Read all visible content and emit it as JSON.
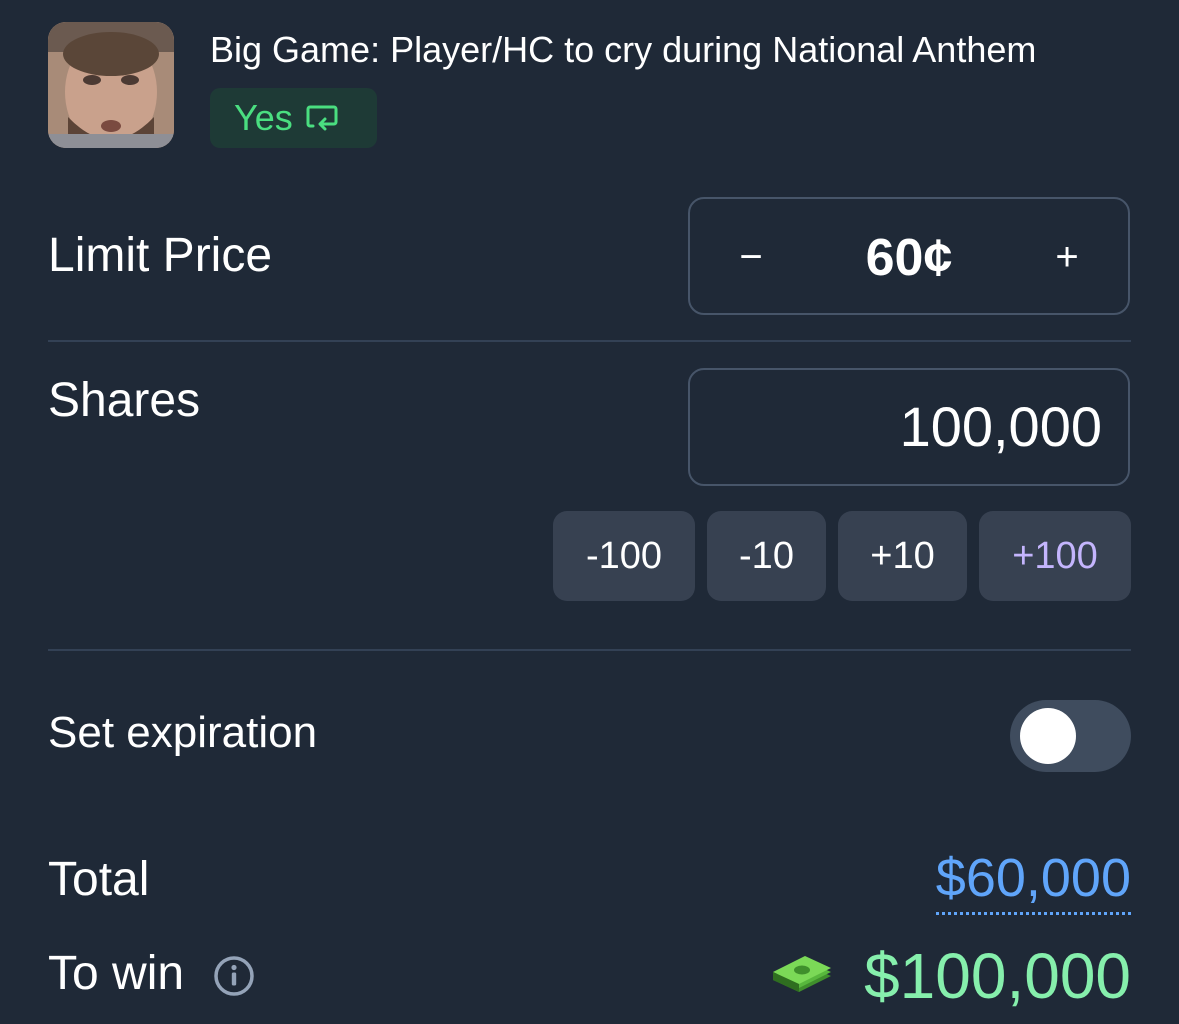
{
  "header": {
    "market_title": "Big Game: Player/HC to cry during National Anthem",
    "outcome_label": "Yes"
  },
  "limit_price": {
    "label": "Limit Price",
    "value": "60¢",
    "decrement_label": "−",
    "increment_label": "+"
  },
  "shares": {
    "label": "Shares",
    "value": "100,000",
    "steps": [
      "-100",
      "-10",
      "+10",
      "+100"
    ]
  },
  "expiration": {
    "label": "Set expiration",
    "enabled": false
  },
  "total": {
    "label": "Total",
    "value": "$60,000"
  },
  "to_win": {
    "label": "To win",
    "value": "$100,000"
  },
  "colors": {
    "background": "#1f2937",
    "yes_green": "#4ade80",
    "total_blue": "#60a5fa",
    "win_green": "#86efac",
    "highlight_purple": "#c4b5fd"
  },
  "icons": [
    "avatar-photo",
    "swap-icon",
    "info-icon",
    "money-icon"
  ]
}
